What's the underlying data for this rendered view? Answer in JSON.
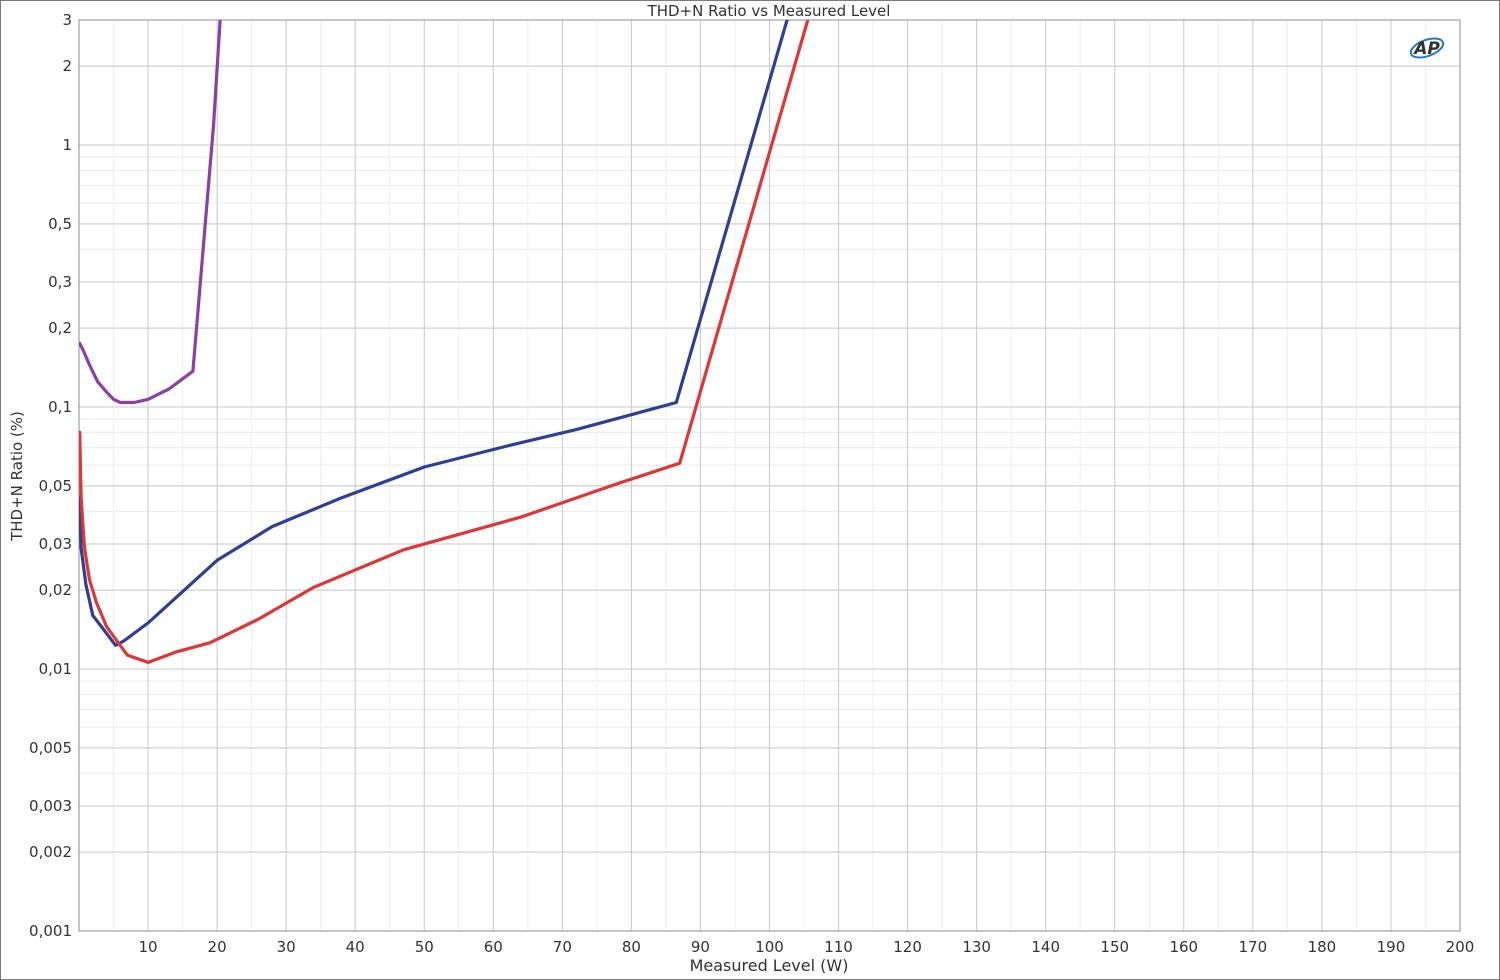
{
  "chart_data": {
    "type": "line",
    "title": "THD+N Ratio vs Measured Level",
    "xlabel": "Measured Level (W)",
    "ylabel": "THD+N Ratio (%)",
    "xlim": [
      0,
      200
    ],
    "ylim": [
      0.001,
      3
    ],
    "y_scale": "log",
    "grid": true,
    "x_ticks": [
      10,
      20,
      30,
      40,
      50,
      60,
      70,
      80,
      90,
      100,
      110,
      120,
      130,
      140,
      150,
      160,
      170,
      180,
      190,
      200
    ],
    "y_ticks": [
      {
        "value": 3,
        "label": "3"
      },
      {
        "value": 2,
        "label": "2"
      },
      {
        "value": 1,
        "label": "1"
      },
      {
        "value": 0.5,
        "label": "0,5"
      },
      {
        "value": 0.3,
        "label": "0,3"
      },
      {
        "value": 0.2,
        "label": "0,2"
      },
      {
        "value": 0.1,
        "label": "0,1"
      },
      {
        "value": 0.05,
        "label": "0,05"
      },
      {
        "value": 0.03,
        "label": "0,03"
      },
      {
        "value": 0.02,
        "label": "0,02"
      },
      {
        "value": 0.01,
        "label": "0,01"
      },
      {
        "value": 0.005,
        "label": "0,005"
      },
      {
        "value": 0.003,
        "label": "0,003"
      },
      {
        "value": 0.002,
        "label": "0,002"
      },
      {
        "value": 0.001,
        "label": "0,001"
      }
    ],
    "series": [
      {
        "color": "#8b3fa6",
        "points": [
          [
            0.1,
            0.175
          ],
          [
            0.6,
            0.165
          ],
          [
            1.5,
            0.145
          ],
          [
            2.7,
            0.125
          ],
          [
            4,
            0.114
          ],
          [
            5,
            0.107
          ],
          [
            6,
            0.104
          ],
          [
            8,
            0.104
          ],
          [
            10,
            0.107
          ],
          [
            13,
            0.117
          ],
          [
            16.5,
            0.137
          ],
          [
            19.5,
            1.2
          ],
          [
            20.5,
            3.2
          ]
        ]
      },
      {
        "color": "#2e3f96",
        "points": [
          [
            0.1,
            0.045
          ],
          [
            0.3,
            0.029
          ],
          [
            1,
            0.021
          ],
          [
            2,
            0.016
          ],
          [
            3,
            0.0148
          ],
          [
            5.3,
            0.0123
          ],
          [
            6.5,
            0.0128
          ],
          [
            10,
            0.015
          ],
          [
            20,
            0.026
          ],
          [
            28,
            0.035
          ],
          [
            38,
            0.045
          ],
          [
            50,
            0.059
          ],
          [
            62,
            0.071
          ],
          [
            72,
            0.082
          ],
          [
            86.5,
            0.104
          ],
          [
            103,
            3.3
          ]
        ]
      },
      {
        "color": "#e03535",
        "points": [
          [
            0.1,
            0.08
          ],
          [
            0.3,
            0.045
          ],
          [
            0.8,
            0.029
          ],
          [
            1.5,
            0.022
          ],
          [
            2.5,
            0.018
          ],
          [
            4,
            0.0145
          ],
          [
            7,
            0.0113
          ],
          [
            10,
            0.0106
          ],
          [
            14,
            0.0116
          ],
          [
            19,
            0.0126
          ],
          [
            26,
            0.0155
          ],
          [
            34,
            0.0205
          ],
          [
            47,
            0.0285
          ],
          [
            64,
            0.038
          ],
          [
            78,
            0.051
          ],
          [
            87,
            0.061
          ],
          [
            106,
            3.3
          ]
        ]
      }
    ]
  },
  "logo": {
    "text": "AP",
    "color": "#1f78c8"
  }
}
